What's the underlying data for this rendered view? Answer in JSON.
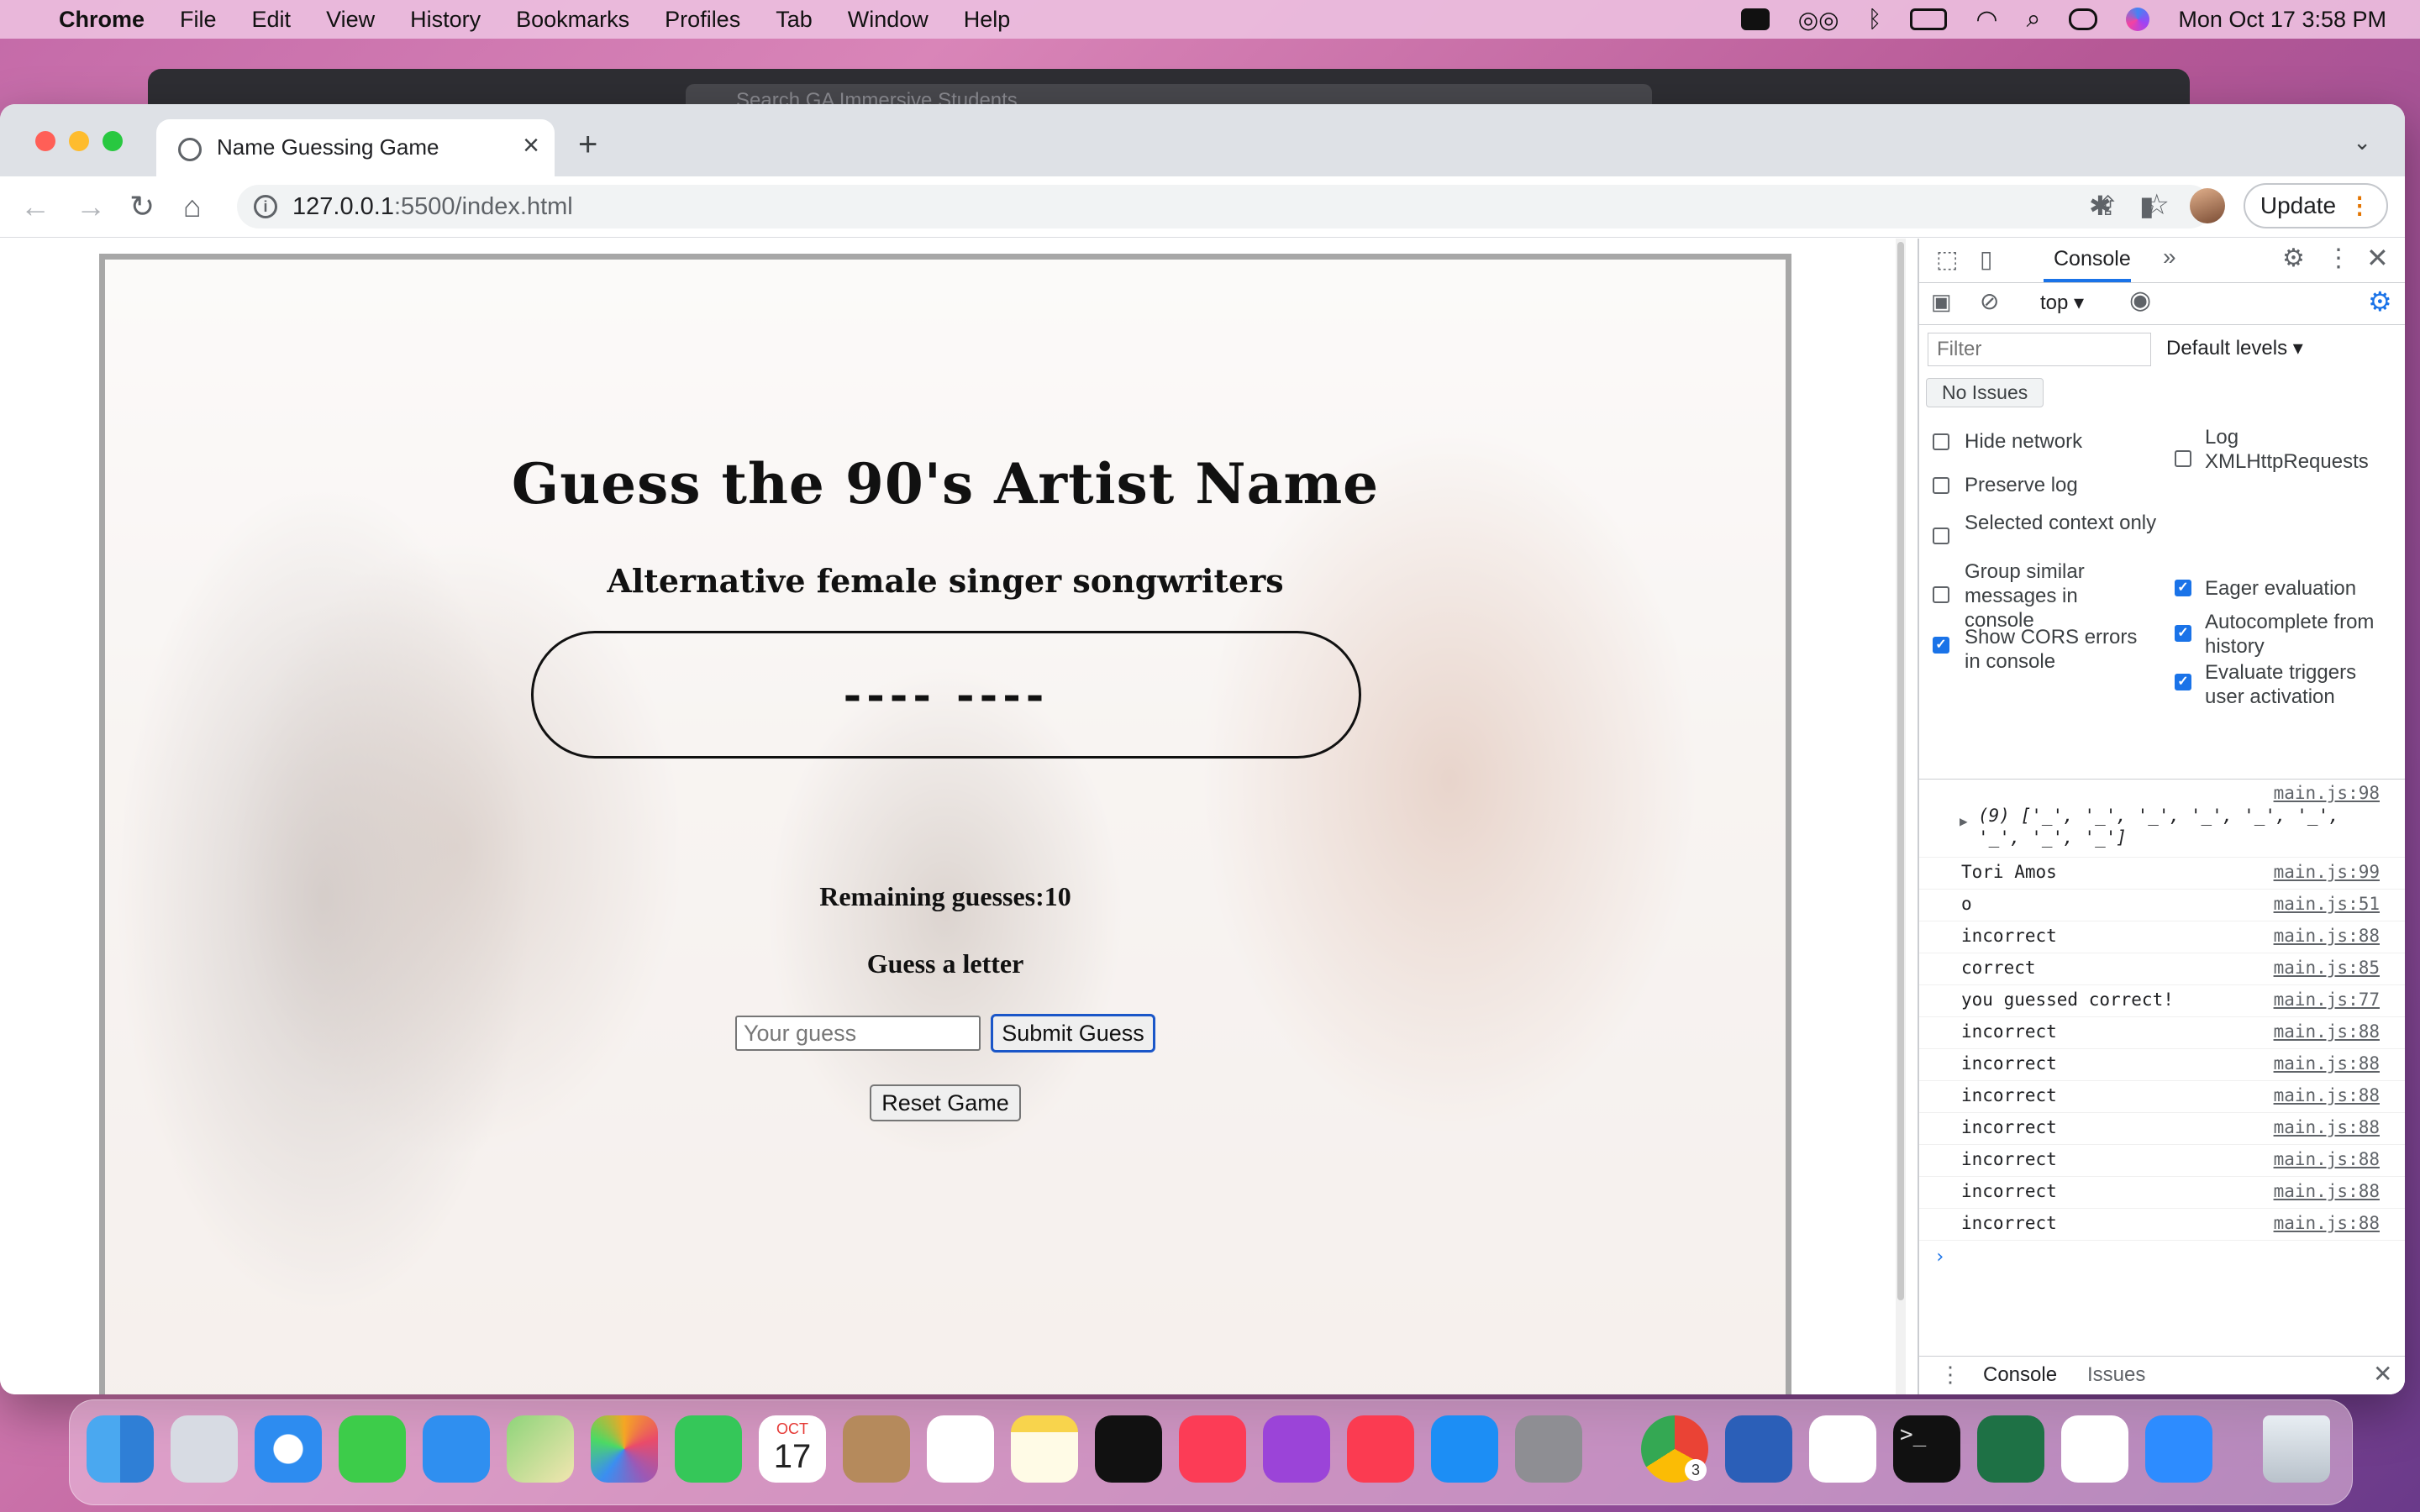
{
  "menubar": {
    "app": "Chrome",
    "items": [
      "File",
      "Edit",
      "View",
      "History",
      "Bookmarks",
      "Profiles",
      "Tab",
      "Window",
      "Help"
    ],
    "clock": "Mon Oct 17  3:58 PM"
  },
  "background_window": {
    "search_placeholder": "Search GA Immersive Students"
  },
  "browser": {
    "tab_title": "Name Guessing Game",
    "url_host": "127.0.0.1",
    "url_rest": ":5500/index.html",
    "update_label": "Update"
  },
  "game": {
    "title": "Guess the 90's Artist Name",
    "subtitle": "Alternative female singer songwriters",
    "word_display": "---- ----",
    "remaining_label": "Remaining guesses:",
    "remaining_count": "10",
    "prompt": "Guess a letter",
    "input_placeholder": "Your guess",
    "submit_label": "Submit Guess",
    "reset_label": "Reset Game"
  },
  "devtools": {
    "active_tab": "Console",
    "context": "top",
    "filter_placeholder": "Filter",
    "levels": "Default levels",
    "issues": "No Issues",
    "settings_left": [
      {
        "label": "Hide network",
        "checked": false
      },
      {
        "label": "Preserve log",
        "checked": false
      },
      {
        "label": "Selected context only",
        "checked": false
      },
      {
        "label": "Group similar messages in console",
        "checked": false
      },
      {
        "label": "Show CORS errors in console",
        "checked": true
      }
    ],
    "settings_right": [
      {
        "label": "Log XMLHttpRequests",
        "checked": false
      },
      {
        "label": "Eager evaluation",
        "checked": true
      },
      {
        "label": "Autocomplete from history",
        "checked": true
      },
      {
        "label": "Evaluate triggers user activation",
        "checked": true
      }
    ],
    "log": [
      {
        "msg": "(9) ['_', '_', '_', '_', '_', '_', '_', '_', '_']",
        "src": "main.js:98",
        "expandable": true
      },
      {
        "msg": "Tori Amos",
        "src": "main.js:99"
      },
      {
        "msg": "o",
        "src": "main.js:51"
      },
      {
        "msg": "incorrect",
        "src": "main.js:88"
      },
      {
        "msg": "correct",
        "src": "main.js:85"
      },
      {
        "msg": "you guessed correct!",
        "src": "main.js:77"
      },
      {
        "msg": "incorrect",
        "src": "main.js:88"
      },
      {
        "msg": "incorrect",
        "src": "main.js:88"
      },
      {
        "msg": "incorrect",
        "src": "main.js:88"
      },
      {
        "msg": "incorrect",
        "src": "main.js:88"
      },
      {
        "msg": "incorrect",
        "src": "main.js:88"
      },
      {
        "msg": "incorrect",
        "src": "main.js:88"
      },
      {
        "msg": "incorrect",
        "src": "main.js:88"
      }
    ],
    "drawer_tabs": [
      "Console",
      "Issues"
    ]
  },
  "dock": {
    "calendar_month": "OCT",
    "calendar_day": "17",
    "chrome_badge": "3",
    "apps": [
      "finder",
      "launchpad",
      "safari",
      "messages",
      "mail",
      "maps",
      "photos",
      "facetime",
      "calendar",
      "contacts",
      "reminders",
      "notes",
      "tv",
      "music",
      "podcasts",
      "news",
      "app-store",
      "system-preferences",
      "chrome",
      "word",
      "slack",
      "terminal",
      "excel",
      "vscode",
      "zoom",
      "trash"
    ]
  }
}
